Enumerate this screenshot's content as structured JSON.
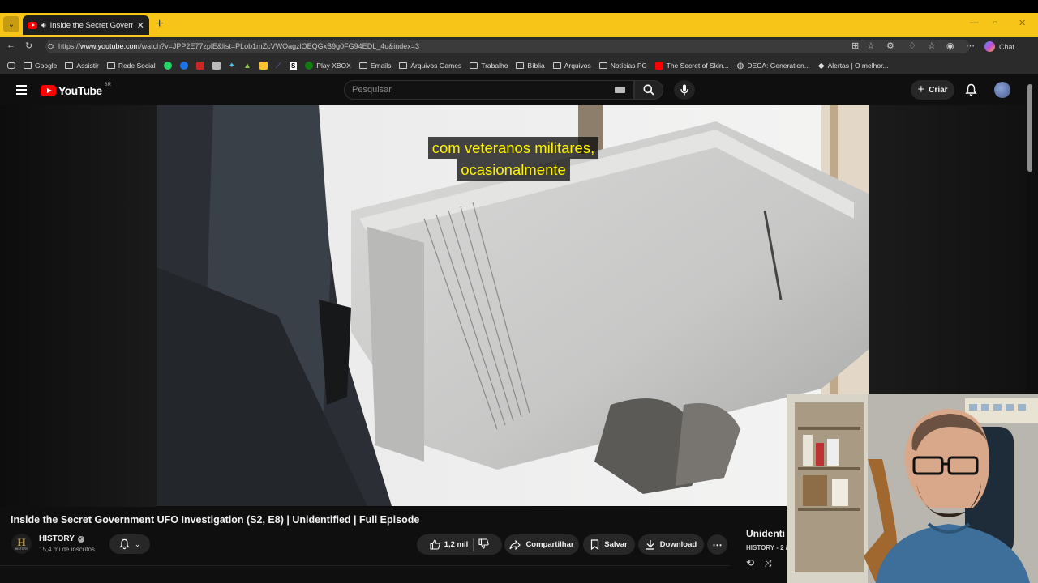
{
  "browser": {
    "tab_title": "Inside the Secret Government",
    "url_prefix": "https://",
    "url_host": "www.youtube.com",
    "url_path": "/watch?v=JPP2E77zplE&list=PLob1mZcVWOagzlOEQGxB9g0FG94EDL_4u&index=3",
    "chat_label": "Chat",
    "tab_bar_color": "#f6c518"
  },
  "bookmarks": [
    {
      "label": "Google",
      "icon": "folder-icon"
    },
    {
      "label": "Assistir",
      "icon": "folder-icon"
    },
    {
      "label": "Rede Social",
      "icon": "folder-icon"
    },
    {
      "label": "",
      "icon": "whatsapp-icon",
      "color": "#25d366"
    },
    {
      "label": "",
      "icon": "blue-circle-icon",
      "color": "#1a73e8"
    },
    {
      "label": "",
      "icon": "red-icon",
      "color": "#c62828"
    },
    {
      "label": "",
      "icon": "square-icon",
      "color": "#bbbbbb"
    },
    {
      "label": "",
      "icon": "star-icon",
      "color": "#4fc3f7"
    },
    {
      "label": "",
      "icon": "green-icon",
      "color": "#8bc34a"
    },
    {
      "label": "",
      "icon": "yellow-icon",
      "color": "#fbc02d"
    },
    {
      "label": "",
      "icon": "chart-icon",
      "color": "#5c6bc0"
    },
    {
      "label": "",
      "icon": "s-icon",
      "color": "#ffffff"
    },
    {
      "label": "Play XBOX",
      "icon": "xbox-icon",
      "color": "#107c10"
    },
    {
      "label": "Emails",
      "icon": "folder-icon"
    },
    {
      "label": "Arquivos Games",
      "icon": "folder-icon"
    },
    {
      "label": "Trabalho",
      "icon": "folder-icon"
    },
    {
      "label": "Bíblia",
      "icon": "folder-icon"
    },
    {
      "label": "Arquivos",
      "icon": "folder-icon"
    },
    {
      "label": "Notícias PC",
      "icon": "folder-icon"
    },
    {
      "label": "The Secret of Skin...",
      "icon": "youtube-icon",
      "color": "#ff0000"
    },
    {
      "label": "DECA: Generation...",
      "icon": "globe-icon"
    },
    {
      "label": "Alertas | O melhor...",
      "icon": "diamond-icon"
    }
  ],
  "youtube": {
    "logo_text": "YouTube",
    "country_code": "BR",
    "search_placeholder": "Pesquisar",
    "create_label": "Criar"
  },
  "player": {
    "caption_line1": "com veteranos militares,",
    "caption_line2": "ocasionalmente",
    "caption_color": "#fff200"
  },
  "video": {
    "title": "Inside the Secret Government UFO Investigation (S2, E8) | Unidentified | Full Episode",
    "channel_name": "HISTORY",
    "channel_logo_text": "H",
    "channel_logo_sub": "HISTORY",
    "subscribers": "15,4 mi de inscritos",
    "likes": "1,2 mil",
    "share_label": "Compartilhar",
    "save_label": "Salvar",
    "download_label": "Download"
  },
  "playlist": {
    "title": "Unidenti",
    "subtitle": "HISTORY - 2 /"
  }
}
